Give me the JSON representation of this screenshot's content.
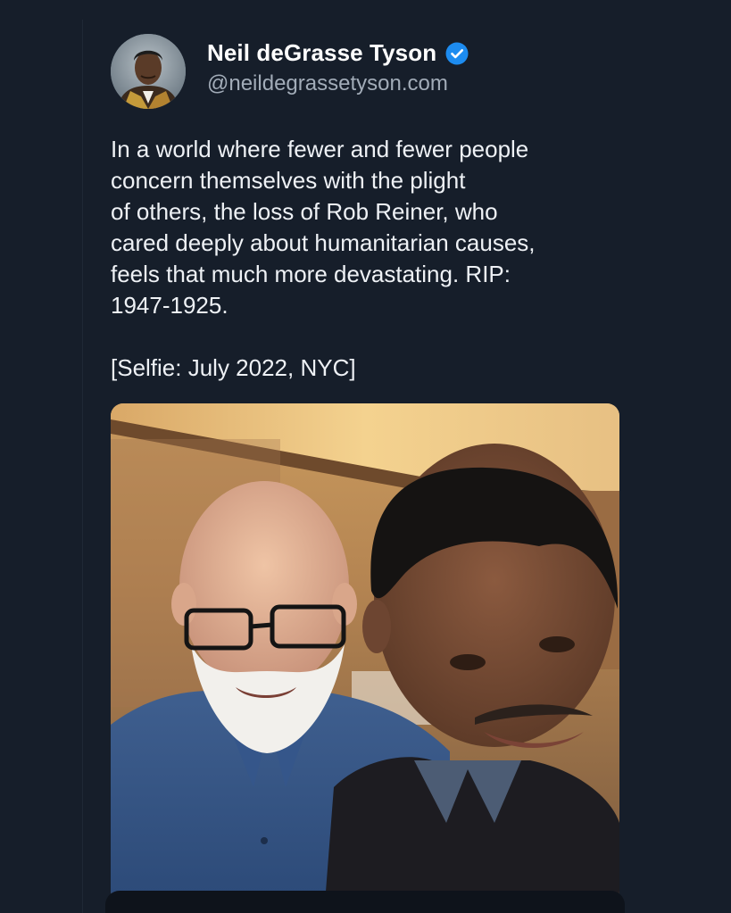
{
  "post": {
    "author": {
      "display_name": "Neil deGrasse Tyson",
      "handle": "@neildegrassetyson.com",
      "verified": true
    },
    "text_lines": [
      "In a world where fewer and fewer people",
      "concern themselves with the plight",
      "of others, the loss of Rob Reiner, who",
      "cared deeply about humanitarian causes,",
      "feels that much more devastating. RIP:",
      "1947-1925."
    ],
    "caption": "[Selfie: July 2022, NYC]",
    "colors": {
      "background": "#161e2a",
      "verified_badge": "#1d8cf0",
      "text": "#eef1f5",
      "handle": "#a2acb8"
    }
  }
}
